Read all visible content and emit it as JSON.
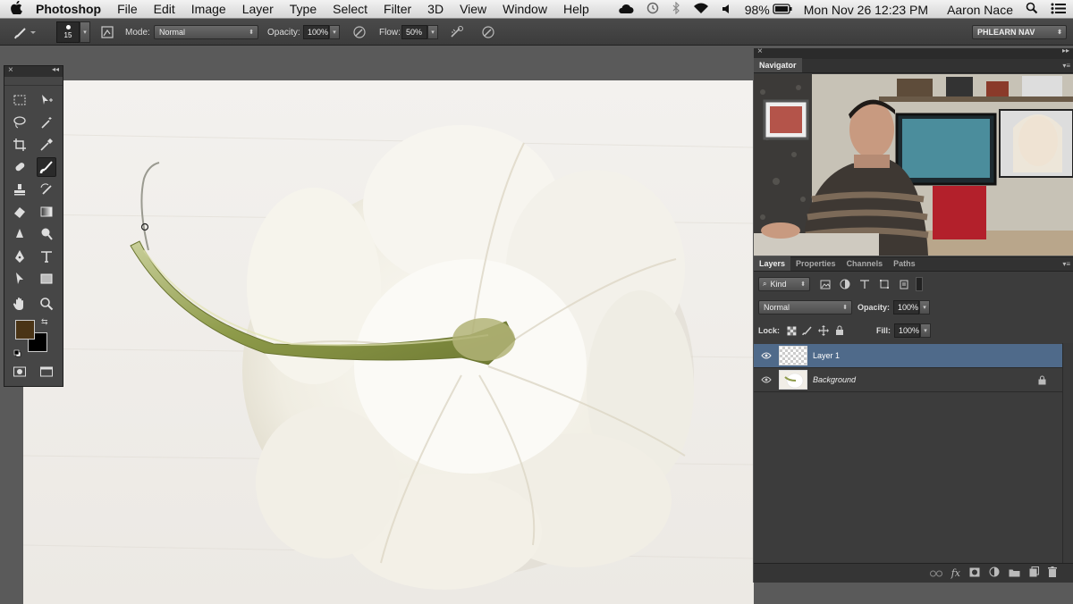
{
  "menubar": {
    "app": "Photoshop",
    "items": [
      "File",
      "Edit",
      "Image",
      "Layer",
      "Type",
      "Select",
      "Filter",
      "3D",
      "View",
      "Window",
      "Help"
    ],
    "battery": "98%",
    "datetime": "Mon Nov 26  12:23 PM",
    "user": "Aaron Nace"
  },
  "options": {
    "brush_size": "15",
    "mode_label": "Mode:",
    "mode_value": "Normal",
    "opacity_label": "Opacity:",
    "opacity_value": "100%",
    "flow_label": "Flow:",
    "flow_value": "50%",
    "workspace": "PHLEARN NAV"
  },
  "navigator": {
    "tab": "Navigator"
  },
  "layers_panel": {
    "tabs": [
      "Layers",
      "Properties",
      "Channels",
      "Paths"
    ],
    "kind_label": "Kind",
    "blend_mode": "Normal",
    "opacity_label": "Opacity:",
    "opacity_value": "100%",
    "lock_label": "Lock:",
    "fill_label": "Fill:",
    "fill_value": "100%",
    "layers": [
      {
        "name": "Layer 1",
        "selected": true,
        "thumb": "transparent"
      },
      {
        "name": "Background",
        "selected": false,
        "thumb": "image",
        "locked": true
      }
    ]
  },
  "tools_panel": {
    "foreground_color": "#4a3416",
    "background_color": "#000000"
  }
}
